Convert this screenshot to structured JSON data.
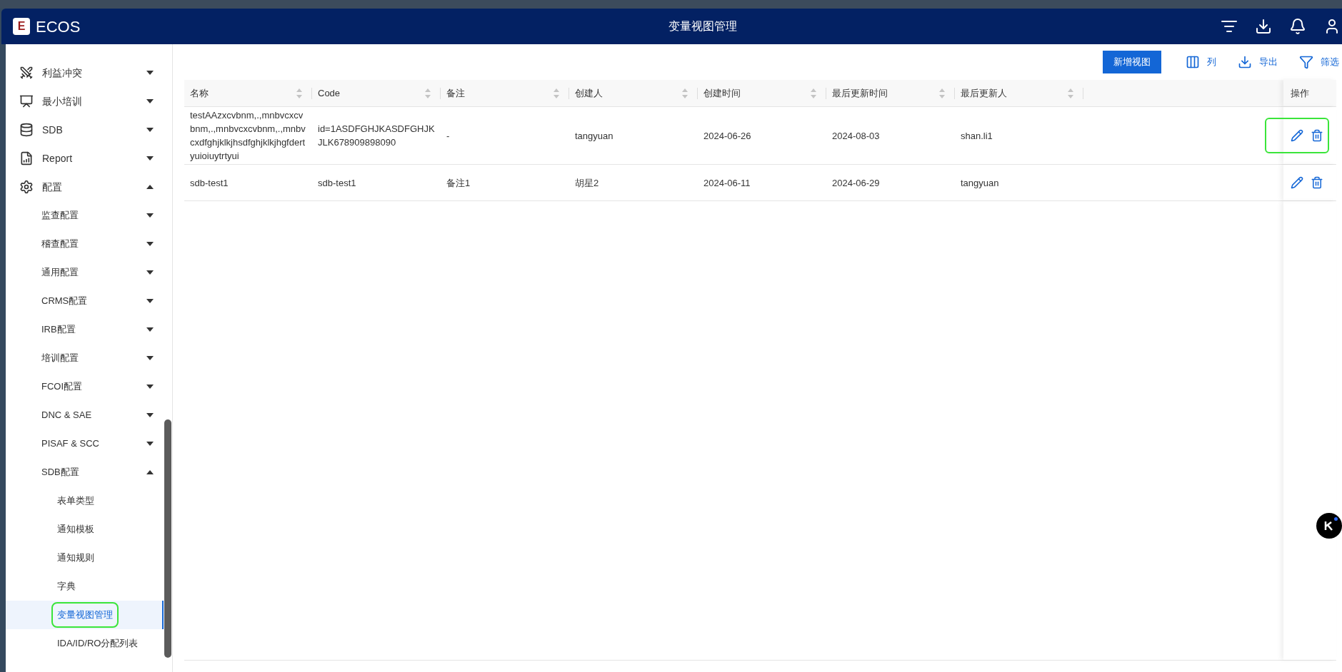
{
  "app": {
    "logo_letter": "E",
    "name": "ECOS",
    "page_title": "变量视图管理"
  },
  "sidebar": {
    "items": [
      {
        "label": "利益冲突",
        "expanded": false
      },
      {
        "label": "最小培训",
        "expanded": false
      },
      {
        "label": "SDB",
        "expanded": false
      },
      {
        "label": "Report",
        "expanded": false
      },
      {
        "label": "配置",
        "expanded": true,
        "children": [
          {
            "label": "监查配置",
            "expanded": false
          },
          {
            "label": "稽查配置",
            "expanded": false
          },
          {
            "label": "通用配置",
            "expanded": false
          },
          {
            "label": "CRMS配置",
            "expanded": false
          },
          {
            "label": "IRB配置",
            "expanded": false
          },
          {
            "label": "培训配置",
            "expanded": false
          },
          {
            "label": "FCOI配置",
            "expanded": false
          },
          {
            "label": "DNC & SAE",
            "expanded": false
          },
          {
            "label": "PISAF & SCC",
            "expanded": false
          },
          {
            "label": "SDB配置",
            "expanded": true,
            "children": [
              {
                "label": "表单类型",
                "selected": false,
                "highlighted": false
              },
              {
                "label": "通知模板",
                "selected": false,
                "highlighted": false
              },
              {
                "label": "通知规则",
                "selected": false,
                "highlighted": false
              },
              {
                "label": "字典",
                "selected": false,
                "highlighted": false
              },
              {
                "label": "变量视图管理",
                "selected": true,
                "highlighted": true
              },
              {
                "label": "IDA/ID/RO分配列表",
                "selected": false,
                "highlighted": false
              }
            ]
          }
        ]
      }
    ]
  },
  "toolbar": {
    "primary": "新增视图",
    "actions": [
      {
        "label": "列"
      },
      {
        "label": "导出"
      },
      {
        "label": "筛选"
      }
    ]
  },
  "table": {
    "columns": [
      "名称",
      "Code",
      "备注",
      "创建人",
      "创建时间",
      "最后更新时间",
      "最后更新人"
    ],
    "actions_column": "操作",
    "rows": [
      {
        "cells": [
          "testAAzxcvbnm,.,mnbvcxcvbnm,.,mnbvcxcvbnm,.,mnbvcxdfghjklkjhsdfghjklkjhgfdertyuioiuytrtyui",
          "id=1ASDFGHJKASDFGHJKJLK678909898090",
          "-",
          "tangyuan",
          "2024-06-26",
          "2024-08-03",
          "shan.li1"
        ],
        "highlighted": true
      },
      {
        "cells": [
          "sdb-test1",
          "sdb-test1",
          "备注1",
          "胡星2",
          "2024-06-11",
          "2024-06-29",
          "tangyuan"
        ],
        "highlighted": false
      }
    ]
  }
}
